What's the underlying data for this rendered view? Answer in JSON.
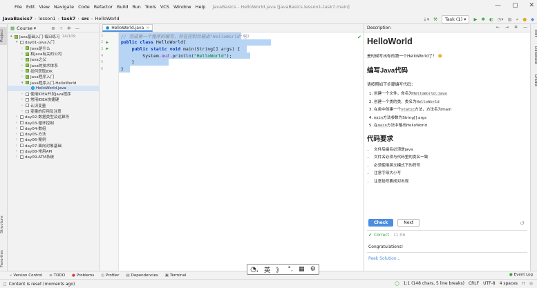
{
  "titlebar": {
    "menu": [
      "File",
      "Edit",
      "View",
      "Navigate",
      "Code",
      "Refactor",
      "Build",
      "Run",
      "Tools",
      "VCS",
      "Window",
      "Help"
    ],
    "window_title": "JavaBasics - HelloWorld.java [JavaBasics.lesson1-task7.main]",
    "min": "—",
    "max": "▢",
    "close": "✕"
  },
  "navbar": {
    "crumbs": [
      "JavaBasics7",
      "lesson1",
      "task7",
      "src",
      "HelloWorld"
    ],
    "task_label": "Task (1) ▾"
  },
  "project": {
    "header": "Course ▾",
    "items": [
      {
        "label": "Java基础入门-每日练习",
        "extra": "14/109",
        "level": 0,
        "arrow": "▾",
        "icon": "g"
      },
      {
        "label": "day01-Java入门",
        "extra": "",
        "level": 1,
        "arrow": "▾",
        "icon": "b"
      },
      {
        "label": "Java是什么",
        "extra": "",
        "level": 2,
        "arrow": "›",
        "icon": "g"
      },
      {
        "label": "和Java有关的公司",
        "extra": "",
        "level": 2,
        "arrow": "›",
        "icon": "g"
      },
      {
        "label": "Java之父",
        "extra": "",
        "level": 2,
        "arrow": "›",
        "icon": "g"
      },
      {
        "label": "Java的技术体系",
        "extra": "",
        "level": 2,
        "arrow": "›",
        "icon": "g"
      },
      {
        "label": "如何获取JDK",
        "extra": "",
        "level": 2,
        "arrow": "›",
        "icon": "g"
      },
      {
        "label": "Java程序入门",
        "extra": "",
        "level": 2,
        "arrow": "›",
        "icon": "g"
      },
      {
        "label": "Java程序入门-HelloWorld",
        "extra": "",
        "level": 2,
        "arrow": "▾",
        "icon": "g"
      },
      {
        "label": "HelloWorld.java",
        "extra": "",
        "level": 3,
        "arrow": "",
        "icon": "c",
        "selected": true
      },
      {
        "label": "使用IDEA开发Java程序",
        "extra": "",
        "level": 2,
        "arrow": "›",
        "icon": "b"
      },
      {
        "label": "常用IDEA快捷键",
        "extra": "",
        "level": 2,
        "arrow": "›",
        "icon": "b"
      },
      {
        "label": "认识变量",
        "extra": "",
        "level": 2,
        "arrow": "›",
        "icon": "b"
      },
      {
        "label": "变量的应用及注意",
        "extra": "",
        "level": 2,
        "arrow": "›",
        "icon": "b"
      },
      {
        "label": "day02-数据类型及运算符",
        "extra": "",
        "level": 1,
        "arrow": "›",
        "icon": "b"
      },
      {
        "label": "day03-循环控制",
        "extra": "",
        "level": 1,
        "arrow": "›",
        "icon": "b"
      },
      {
        "label": "day04-数组",
        "extra": "",
        "level": 1,
        "arrow": "›",
        "icon": "b"
      },
      {
        "label": "day05-方法",
        "extra": "",
        "level": 1,
        "arrow": "›",
        "icon": "b"
      },
      {
        "label": "day06-案例",
        "extra": "",
        "level": 1,
        "arrow": "›",
        "icon": "b"
      },
      {
        "label": "day07-面向对象基础",
        "extra": "",
        "level": 1,
        "arrow": "›",
        "icon": "b"
      },
      {
        "label": "day08-常用API",
        "extra": "",
        "level": 1,
        "arrow": "›",
        "icon": "b"
      },
      {
        "label": "day09-ATM系统",
        "extra": "",
        "level": 1,
        "arrow": "›",
        "icon": "b"
      }
    ]
  },
  "editor": {
    "tab": "HelloWorld.java",
    "lines": [
      "1",
      "2",
      "3",
      "4",
      "5",
      "6"
    ],
    "comment": "// 完成第一个程序的编写，并在控制台输出\"HelloWorld\"吧！"
  },
  "description": {
    "header": "Description",
    "title": "HelloWorld",
    "intro": "是时候写出你的第一个HelloWorld了！",
    "h_code": "编写Java代码",
    "steps_intro": "请按照如下步骤编写代码：",
    "steps": [
      {
        "pre": "创建一个文件，命名为",
        "code": "HelloWorld.java",
        "post": ""
      },
      {
        "pre": "创建一个类的类，类名为",
        "code": "HelloWorld",
        "post": ""
      },
      {
        "pre": "在类中创建一个",
        "code": "static",
        "post": "方法，方法名为main"
      },
      {
        "pre": "",
        "code": "main",
        "post": "方法参数为String[] args"
      },
      {
        "pre": "在",
        "code": "main",
        "post": "方法中输出HelloWorld"
      }
    ],
    "h_req": "代码要求",
    "reqs": [
      "文件后缀名必须是java",
      "文件名必须与代码里的类名一致",
      "必须使用英文模式下的符号",
      "注意字母大小写",
      "注意括号要成对出现"
    ],
    "check": "Check",
    "next": "Next",
    "correct": "Correct",
    "correct_time": "11:06",
    "congrats": "Congratulations!",
    "peek": "Peek Solution..."
  },
  "toolwindows": [
    "Version Control",
    "TODO",
    "Problems",
    "Profiler",
    "Dependencies",
    "Terminal"
  ],
  "toolbar_right": "Event Log",
  "status": {
    "left": "Content is reset (moments ago)",
    "pos": "1:1 (148 chars, 5 line breaks)",
    "crlf": "CRLF",
    "enc": "UTF-8",
    "indent": "4 spaces"
  },
  "ime": [
    "英",
    "》",
    "°,",
    "▦",
    "⚙"
  ],
  "sidebars": {
    "left": [
      "Project",
      "Structure",
      "Favorites"
    ],
    "right": [
      "Edit",
      "Database",
      "Gradle"
    ]
  }
}
